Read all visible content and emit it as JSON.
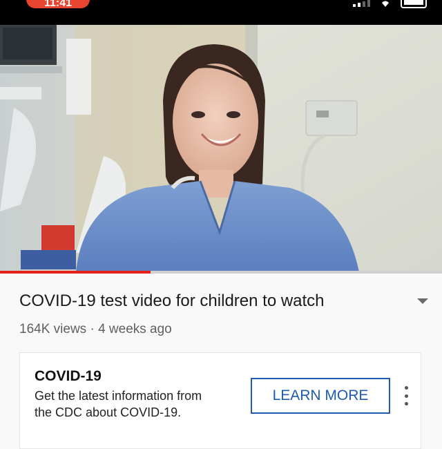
{
  "status_bar": {
    "time": "11:41"
  },
  "video": {
    "progress_fraction": 0.34
  },
  "video_info": {
    "title": "COVID-19 test video for children to watch",
    "views": "164K views",
    "separator": "·",
    "age": "4 weeks ago"
  },
  "ad_card": {
    "title": "COVID-19",
    "description_line1": "Get the latest information from",
    "description_line2": "the CDC about COVID-19.",
    "cta_label": "LEARN MORE"
  },
  "colors": {
    "accent": "#e62117",
    "cta": "#1d5bb1"
  }
}
